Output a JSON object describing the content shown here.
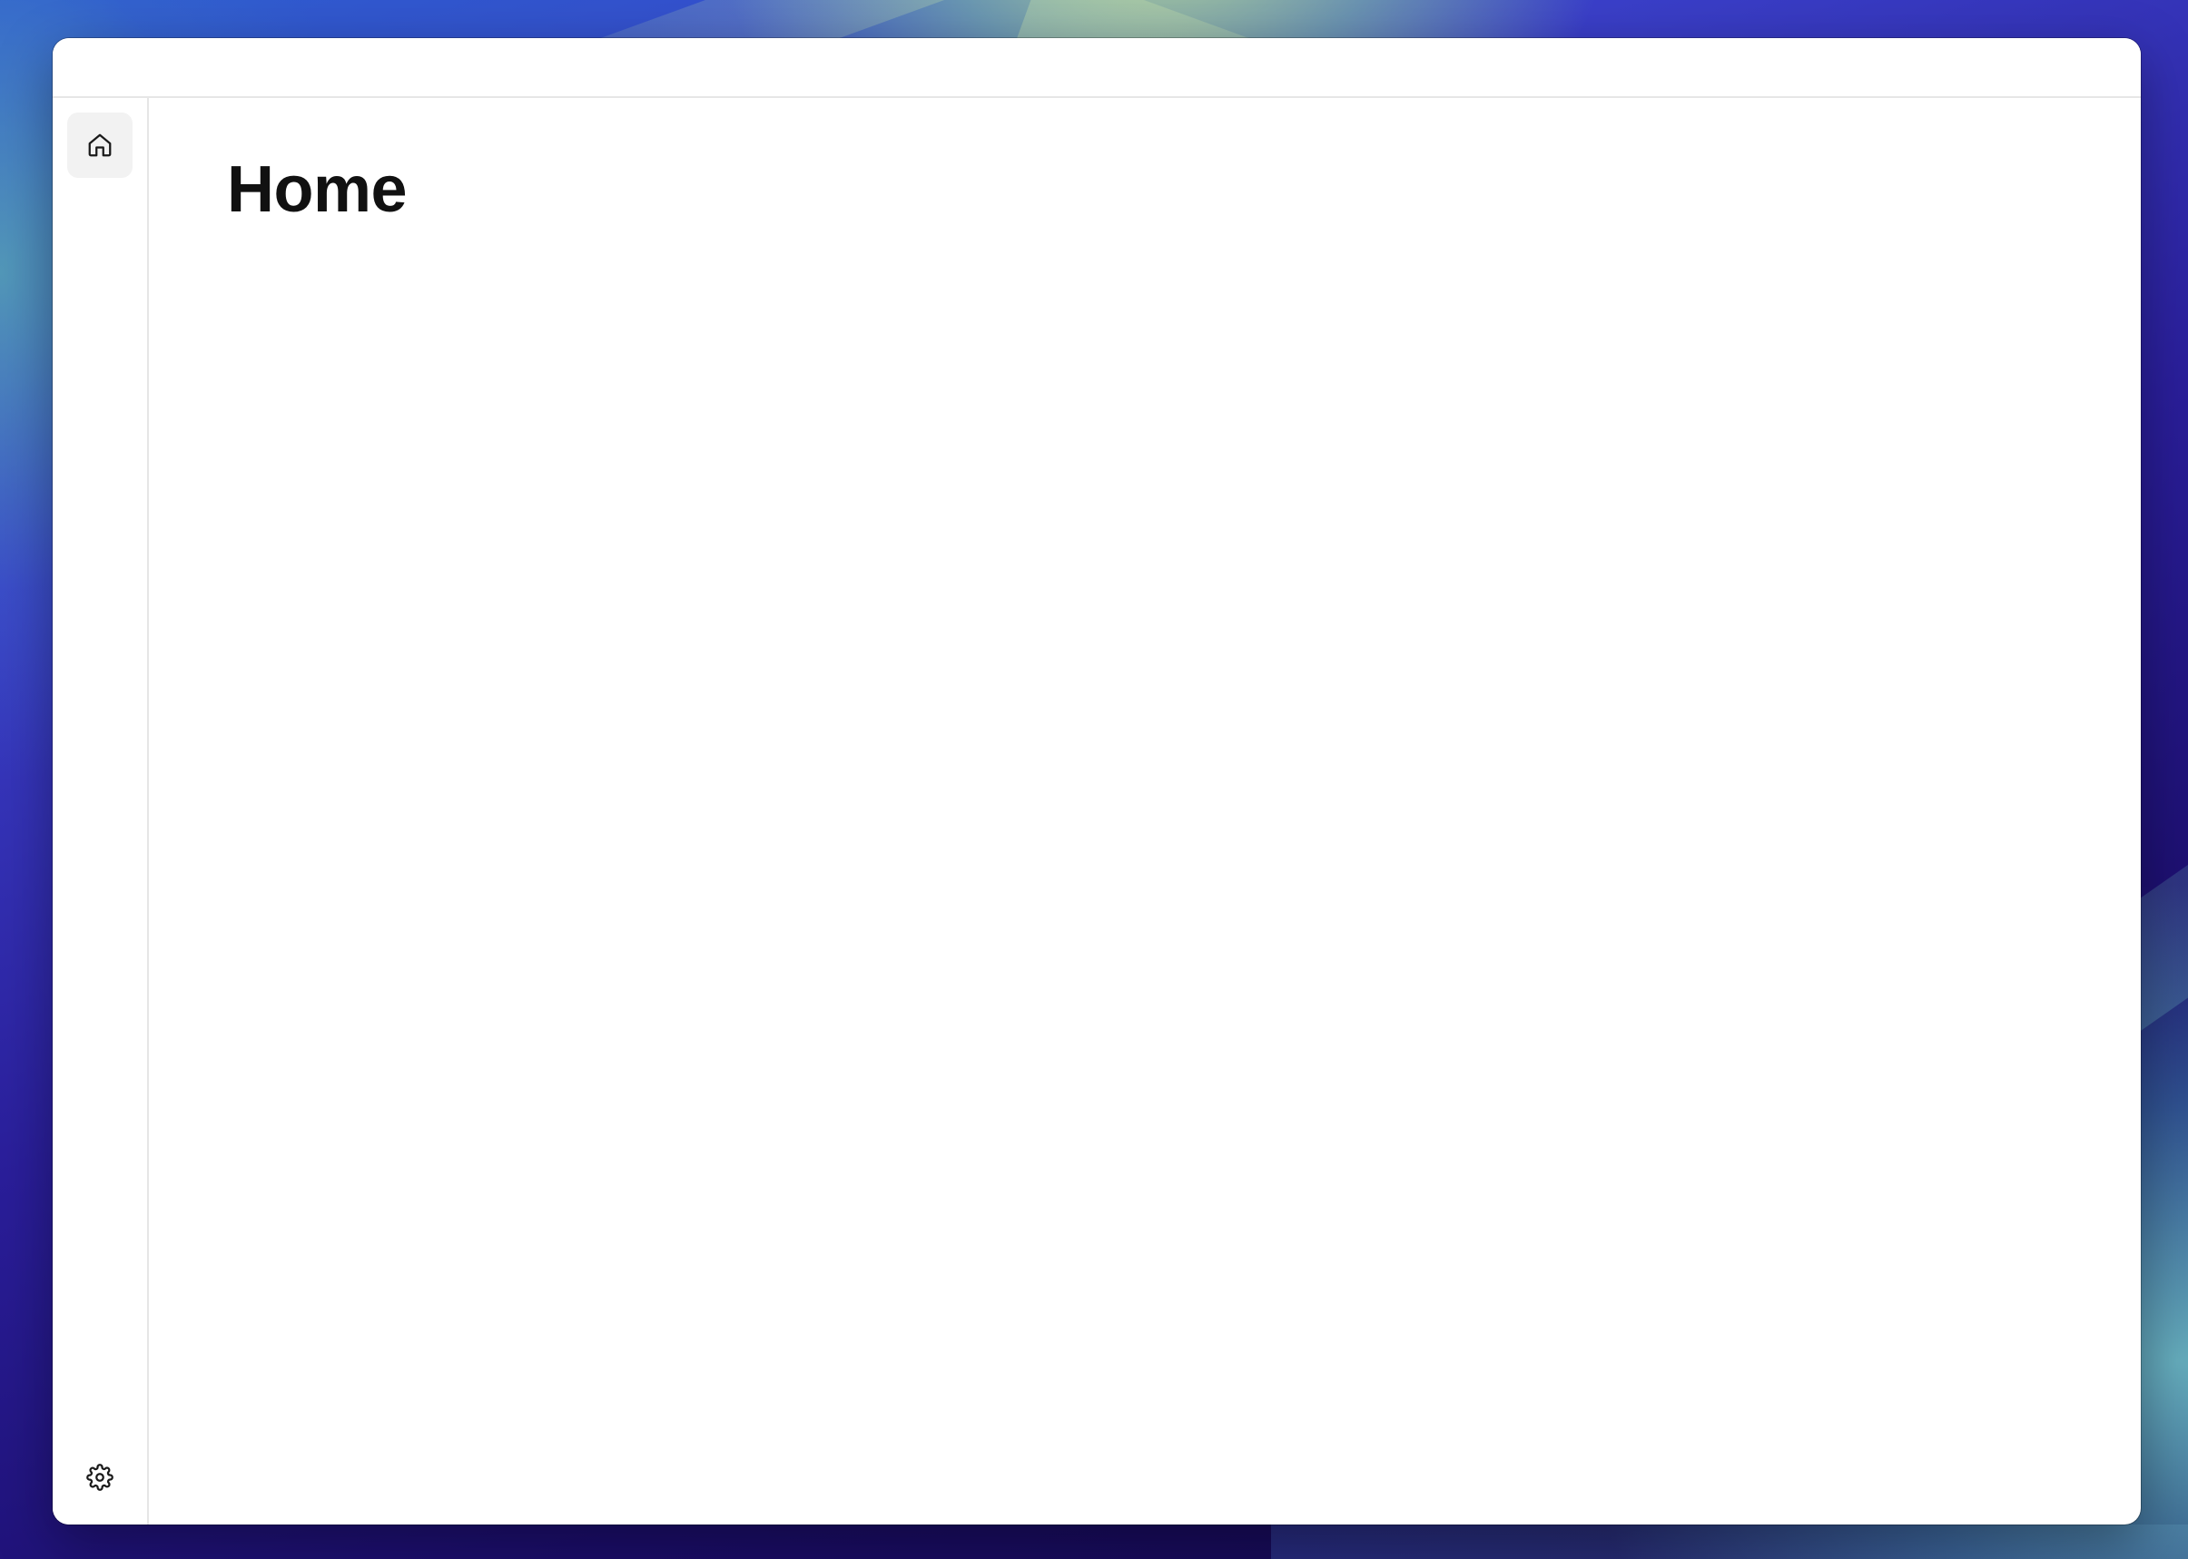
{
  "desktop": {
    "wallpaper_colors": [
      "#2e5fd0",
      "#2a1e9a",
      "#120842",
      "#8cc8a0"
    ]
  },
  "sidebar": {
    "items": [
      {
        "icon": "home-icon",
        "active": true
      }
    ],
    "footer": {
      "icon": "gear-icon"
    }
  },
  "main": {
    "title": "Home"
  },
  "colors": {
    "active_nav_bg": "#f2f2f2",
    "divider": "#e6e6e6",
    "title_text": "#111111"
  }
}
